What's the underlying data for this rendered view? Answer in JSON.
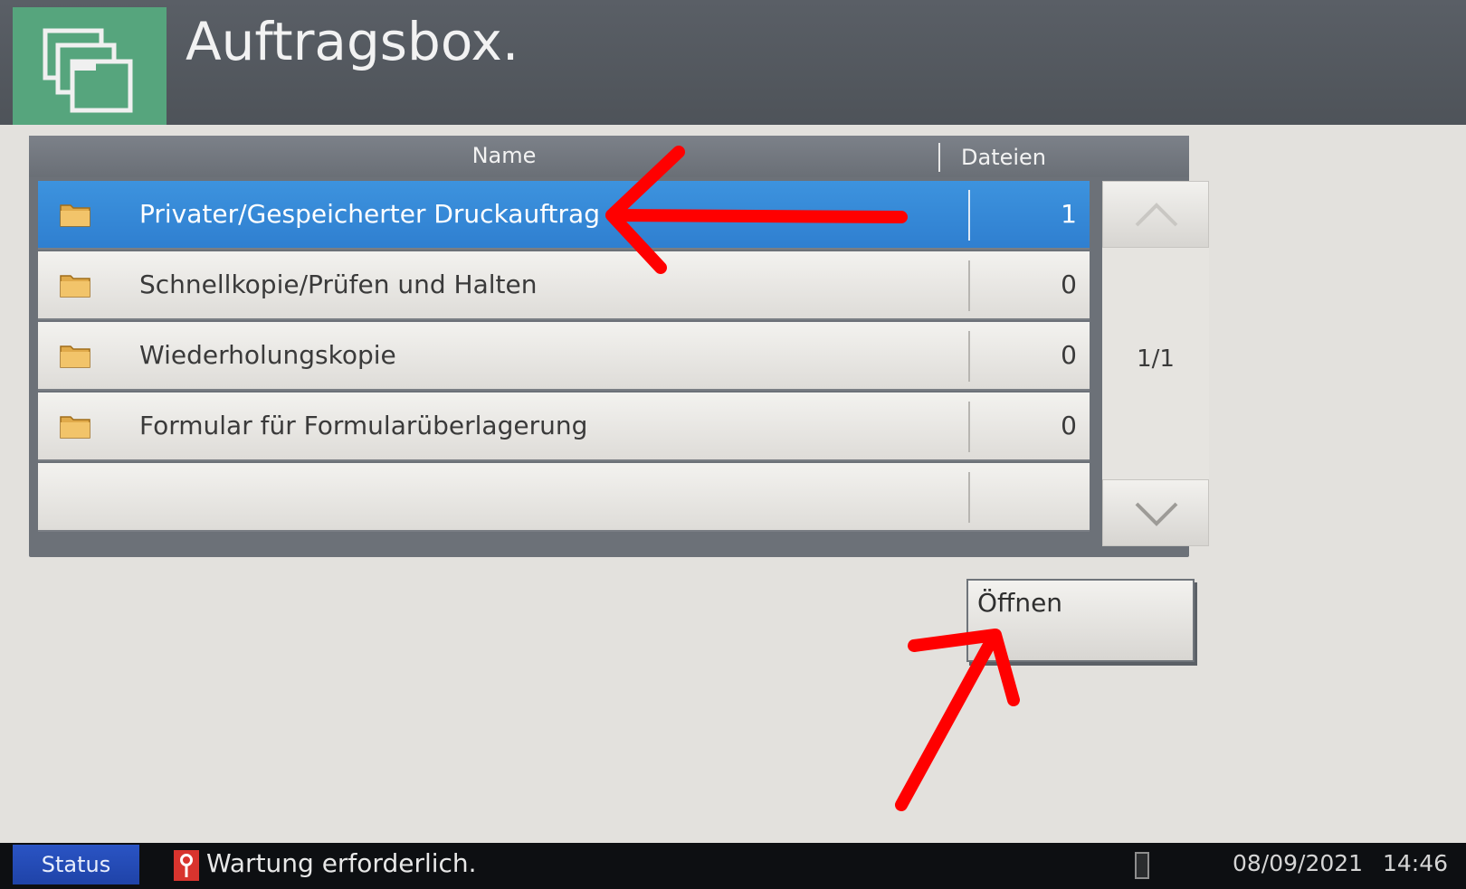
{
  "header": {
    "title": "Auftragsbox.",
    "icon": "job-box-icon",
    "accent_color": "#56a57d"
  },
  "list": {
    "columns": {
      "name": "Name",
      "files": "Dateien"
    },
    "rows": [
      {
        "label": "Privater/Gespeicherter Druckauftrag",
        "count": "1",
        "selected": true
      },
      {
        "label": "Schnellkopie/Prüfen und Halten",
        "count": "0",
        "selected": false
      },
      {
        "label": "Wiederholungskopie",
        "count": "0",
        "selected": false
      },
      {
        "label": "Formular für Formularüberlagerung",
        "count": "0",
        "selected": false
      },
      {
        "label": "",
        "count": "",
        "selected": false
      }
    ],
    "selected_color": "#2f86d6",
    "page_indicator": "1/1"
  },
  "actions": {
    "open_label": "Öffnen"
  },
  "status_bar": {
    "status_label": "Status",
    "message": "Wartung erforderlich.",
    "date": "08/09/2021",
    "time": "14:46",
    "status_color": "#2450b8"
  },
  "annotations": {
    "arrow_color": "#ff0000"
  }
}
